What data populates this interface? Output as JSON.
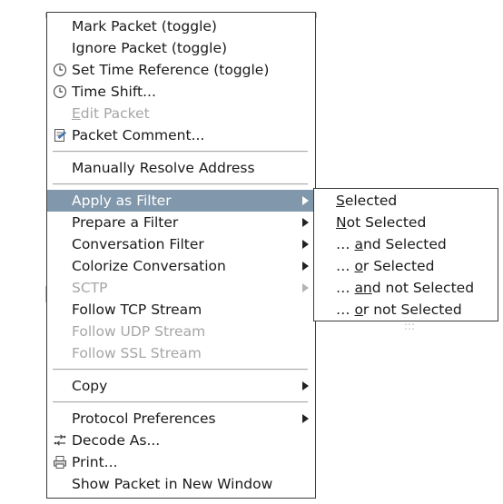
{
  "context_menu": {
    "items": [
      {
        "label": "Mark Packet (toggle)",
        "icon": null,
        "enabled": true,
        "submenu": false
      },
      {
        "label": "Ignore Packet (toggle)",
        "icon": null,
        "enabled": true,
        "submenu": false
      },
      {
        "label": "Set Time Reference (toggle)",
        "icon": "clock-icon",
        "enabled": true,
        "submenu": false
      },
      {
        "label": "Time Shift...",
        "icon": "clock-icon",
        "enabled": true,
        "submenu": false
      },
      {
        "label_mnemonic": "E",
        "label_rest": "dit Packet",
        "icon": null,
        "enabled": false,
        "submenu": false
      },
      {
        "label": "Packet Comment...",
        "icon": "comment-icon",
        "enabled": true,
        "submenu": false
      },
      {
        "label": "Manually Resolve Address",
        "icon": null,
        "enabled": true,
        "submenu": false
      },
      {
        "label": "Apply as Filter",
        "icon": null,
        "enabled": true,
        "submenu": true,
        "selected": true
      },
      {
        "label": "Prepare a Filter",
        "icon": null,
        "enabled": true,
        "submenu": true
      },
      {
        "label": "Conversation Filter",
        "icon": null,
        "enabled": true,
        "submenu": true
      },
      {
        "label": "Colorize Conversation",
        "icon": null,
        "enabled": true,
        "submenu": true
      },
      {
        "label": "SCTP",
        "icon": null,
        "enabled": false,
        "submenu": true
      },
      {
        "label": "Follow TCP Stream",
        "icon": null,
        "enabled": true,
        "submenu": false
      },
      {
        "label": "Follow UDP Stream",
        "icon": null,
        "enabled": false,
        "submenu": false
      },
      {
        "label": "Follow SSL Stream",
        "icon": null,
        "enabled": false,
        "submenu": false
      },
      {
        "label": "Copy",
        "icon": null,
        "enabled": true,
        "submenu": true
      },
      {
        "label": "Protocol Preferences",
        "icon": null,
        "enabled": true,
        "submenu": true
      },
      {
        "label": "Decode As...",
        "icon": "decode-icon",
        "enabled": true,
        "submenu": false
      },
      {
        "label": "Print...",
        "icon": "printer-icon",
        "enabled": true,
        "submenu": false
      },
      {
        "label": "Show Packet in New Window",
        "icon": null,
        "enabled": true,
        "submenu": false
      }
    ]
  },
  "apply_as_filter_submenu": {
    "items": [
      {
        "prefix": "",
        "mnemonic": "S",
        "rest": "elected"
      },
      {
        "prefix": "",
        "mnemonic": "N",
        "rest": "ot Selected"
      },
      {
        "prefix": "… ",
        "mnemonic": "a",
        "rest": "nd Selected"
      },
      {
        "prefix": "… ",
        "mnemonic": "o",
        "rest": "r Selected"
      },
      {
        "prefix": "… ",
        "mnemonic": "an",
        "rest": "d not Selected"
      },
      {
        "prefix": "… ",
        "mnemonic": "o",
        "rest": "r not Selected"
      }
    ]
  },
  "colors": {
    "selected_background": "#8197ab",
    "disabled_text": "#a6a6a6",
    "border": "#3c3c3c"
  }
}
